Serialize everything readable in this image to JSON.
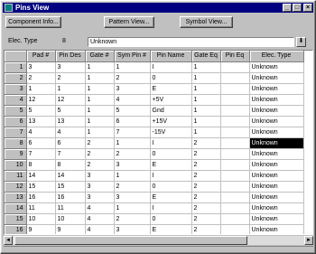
{
  "window": {
    "title": "Pins View",
    "minimize_glyph": "_",
    "maximize_glyph": "□",
    "close_glyph": "×"
  },
  "toolbar": {
    "component_info_label": "Component Info...",
    "pattern_view_label": "Pattern View...",
    "symbol_view_label": "Symbol View..."
  },
  "elec_type": {
    "label": "Elec. Type",
    "count": "8",
    "value": "Unknown",
    "dropdown_glyph": "⬇"
  },
  "grid": {
    "columns": [
      "Pad #",
      "Pin Des",
      "Gate #",
      "Sym Pin #",
      "Pin Name",
      "Gate Eq",
      "Pin Eq",
      "Elec. Type"
    ],
    "selected_row": 8,
    "selected_col": 7,
    "rows": [
      [
        "1",
        "3",
        "3",
        "1",
        "1",
        "I",
        "1",
        "",
        "Unknown"
      ],
      [
        "2",
        "2",
        "2",
        "1",
        "2",
        "0",
        "1",
        "",
        "Unknown"
      ],
      [
        "3",
        "1",
        "1",
        "1",
        "3",
        "E",
        "1",
        "",
        "Unknown"
      ],
      [
        "4",
        "12",
        "12",
        "1",
        "4",
        "+5V",
        "1",
        "",
        "Unknown"
      ],
      [
        "5",
        "5",
        "5",
        "1",
        "5",
        "Gnd",
        "1",
        "",
        "Unknown"
      ],
      [
        "6",
        "13",
        "13",
        "1",
        "6",
        "+15V",
        "1",
        "",
        "Unknown"
      ],
      [
        "7",
        "4",
        "4",
        "1",
        "7",
        "-15V",
        "1",
        "",
        "Unknown"
      ],
      [
        "8",
        "6",
        "6",
        "2",
        "1",
        "I",
        "2",
        "",
        "Unknown"
      ],
      [
        "9",
        "7",
        "7",
        "2",
        "2",
        "0",
        "2",
        "",
        "Unknown"
      ],
      [
        "10",
        "8",
        "8",
        "2",
        "3",
        "E",
        "2",
        "",
        "Unknown"
      ],
      [
        "11",
        "14",
        "14",
        "3",
        "1",
        "I",
        "2",
        "",
        "Unknown"
      ],
      [
        "12",
        "15",
        "15",
        "3",
        "2",
        "0",
        "2",
        "",
        "Unknown"
      ],
      [
        "13",
        "16",
        "16",
        "3",
        "3",
        "E",
        "2",
        "",
        "Unknown"
      ],
      [
        "14",
        "11",
        "11",
        "4",
        "1",
        "I",
        "2",
        "",
        "Unknown"
      ],
      [
        "15",
        "10",
        "10",
        "4",
        "2",
        "0",
        "2",
        "",
        "Unknown"
      ],
      [
        "16",
        "9",
        "9",
        "4",
        "3",
        "E",
        "2",
        "",
        "Unknown"
      ]
    ]
  },
  "colors": {
    "titlebar": "#000080",
    "face": "#c0c0c0",
    "selection": "#000000"
  }
}
